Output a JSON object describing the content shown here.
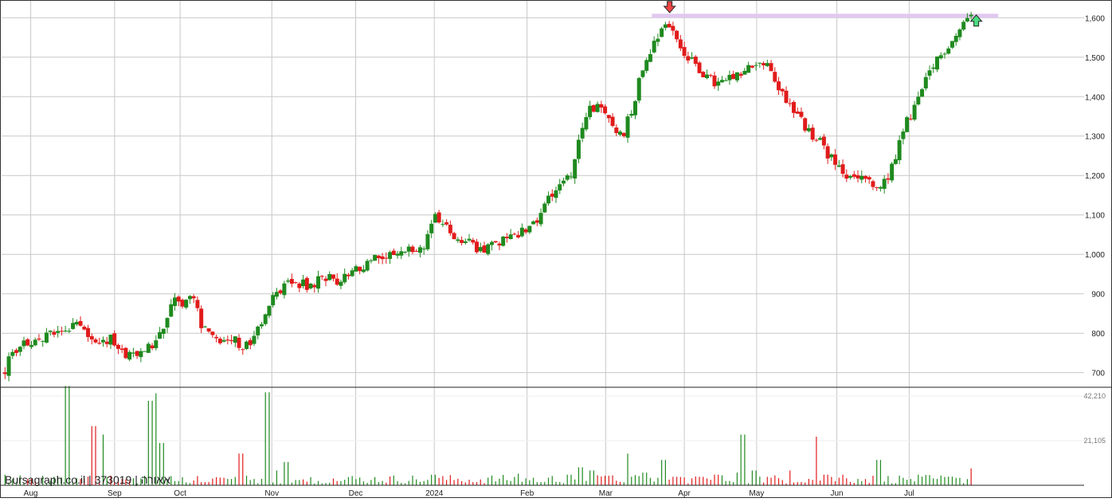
{
  "chart_data": {
    "type": "candlestick",
    "watermark": "Bursagraph.co.il | 373019 | אאורה",
    "grid": true,
    "price_axis": {
      "position": "right",
      "ylim": [
        665,
        1645
      ],
      "ticks": [
        "1,600",
        "1,500",
        "1,400",
        "1,300",
        "1,200",
        "1,100",
        "1,000",
        "900",
        "800",
        "700"
      ],
      "tick_values": [
        1600,
        1500,
        1400,
        1300,
        1200,
        1100,
        1000,
        900,
        800,
        700
      ]
    },
    "volume_axis": {
      "position": "right",
      "ylim": [
        0,
        44500
      ],
      "ticks": [
        "42,210",
        "21,105"
      ],
      "tick_values": [
        42210,
        21105
      ]
    },
    "x_axis": {
      "labels": [
        "Aug",
        "Sep",
        "Oct",
        "Nov",
        "Dec",
        "2024",
        "Feb",
        "Mar",
        "Apr",
        "May",
        "Jun",
        "Jul"
      ],
      "label_positions_week": [
        5.1,
        21.1,
        33.6,
        51.1,
        67.1,
        82.1,
        99.8,
        114.8,
        129.8,
        143.6,
        158.9,
        172.7
      ]
    },
    "resistance_level": {
      "value": 1605,
      "from_week": 123.6,
      "to_week": 189.7,
      "color": "#e2c8f0"
    },
    "markers": [
      {
        "type": "sell-arrow",
        "week": 127,
        "value": 1625,
        "color": "#ef4444"
      },
      {
        "type": "buy-arrow",
        "week": 185.5,
        "value": 1595,
        "color": "#4ade80"
      }
    ],
    "colors": {
      "up": "#1f8a1f",
      "down": "#e11b1b"
    },
    "series_close": [
      [
        0,
        700
      ],
      [
        2,
        760
      ],
      [
        4,
        780
      ],
      [
        6,
        770
      ],
      [
        8,
        800
      ],
      [
        10,
        805
      ],
      [
        12,
        815
      ],
      [
        14,
        820
      ],
      [
        16,
        785
      ],
      [
        18,
        770
      ],
      [
        20,
        790
      ],
      [
        22,
        760
      ],
      [
        24,
        745
      ],
      [
        26,
        750
      ],
      [
        28,
        770
      ],
      [
        30,
        800
      ],
      [
        32,
        880
      ],
      [
        34,
        880
      ],
      [
        36,
        900
      ],
      [
        38,
        810
      ],
      [
        40,
        800
      ],
      [
        42,
        770
      ],
      [
        44,
        780
      ],
      [
        46,
        760
      ],
      [
        48,
        800
      ],
      [
        50,
        850
      ],
      [
        52,
        900
      ],
      [
        54,
        920
      ],
      [
        56,
        930
      ],
      [
        58,
        920
      ],
      [
        60,
        935
      ],
      [
        62,
        940
      ],
      [
        64,
        930
      ],
      [
        66,
        950
      ],
      [
        68,
        960
      ],
      [
        70,
        990
      ],
      [
        72,
        1000
      ],
      [
        74,
        990
      ],
      [
        76,
        1010
      ],
      [
        78,
        1020
      ],
      [
        80,
        1020
      ],
      [
        82,
        1100
      ],
      [
        84,
        1080
      ],
      [
        86,
        1040
      ],
      [
        88,
        1030
      ],
      [
        90,
        1020
      ],
      [
        92,
        1010
      ],
      [
        94,
        1030
      ],
      [
        96,
        1040
      ],
      [
        98,
        1050
      ],
      [
        100,
        1070
      ],
      [
        102,
        1090
      ],
      [
        104,
        1150
      ],
      [
        106,
        1180
      ],
      [
        108,
        1200
      ],
      [
        110,
        1300
      ],
      [
        112,
        1380
      ],
      [
        114,
        1360
      ],
      [
        116,
        1330
      ],
      [
        118,
        1300
      ],
      [
        120,
        1380
      ],
      [
        122,
        1480
      ],
      [
        124,
        1540
      ],
      [
        126,
        1590
      ],
      [
        128,
        1560
      ],
      [
        130,
        1500
      ],
      [
        132,
        1480
      ],
      [
        134,
        1450
      ],
      [
        136,
        1430
      ],
      [
        138,
        1440
      ],
      [
        140,
        1450
      ],
      [
        142,
        1470
      ],
      [
        144,
        1490
      ],
      [
        146,
        1470
      ],
      [
        148,
        1420
      ],
      [
        150,
        1380
      ],
      [
        152,
        1340
      ],
      [
        154,
        1300
      ],
      [
        156,
        1280
      ],
      [
        158,
        1240
      ],
      [
        160,
        1200
      ],
      [
        162,
        1190
      ],
      [
        164,
        1200
      ],
      [
        166,
        1160
      ],
      [
        168,
        1180
      ],
      [
        170,
        1240
      ],
      [
        172,
        1330
      ],
      [
        174,
        1380
      ],
      [
        176,
        1440
      ],
      [
        178,
        1490
      ],
      [
        180,
        1530
      ],
      [
        182,
        1560
      ],
      [
        184,
        1610
      ],
      [
        185,
        1600
      ]
    ],
    "volume_samples": [
      [
        0,
        5000
      ],
      [
        5,
        3000
      ],
      [
        10,
        4000
      ],
      [
        12,
        47000
      ],
      [
        15,
        3000
      ],
      [
        17,
        28000
      ],
      [
        19,
        24000
      ],
      [
        22,
        3000
      ],
      [
        24,
        2000
      ],
      [
        27,
        4500
      ],
      [
        28,
        40000
      ],
      [
        29,
        43500
      ],
      [
        30,
        20000
      ],
      [
        33,
        2000
      ],
      [
        38,
        1500
      ],
      [
        43,
        3000
      ],
      [
        45,
        15000
      ],
      [
        47,
        2500
      ],
      [
        50,
        44000
      ],
      [
        52,
        7000
      ],
      [
        54,
        11000
      ],
      [
        56,
        2500
      ],
      [
        60,
        2000
      ],
      [
        64,
        2000
      ],
      [
        70,
        2500
      ],
      [
        80,
        2000
      ],
      [
        82,
        5000
      ],
      [
        90,
        1500
      ],
      [
        98,
        5500
      ],
      [
        102,
        1500
      ],
      [
        108,
        5000
      ],
      [
        110,
        8500
      ],
      [
        112,
        7000
      ],
      [
        115,
        4500
      ],
      [
        119,
        15000
      ],
      [
        122,
        6000
      ],
      [
        126,
        12000
      ],
      [
        128,
        4000
      ],
      [
        133,
        4000
      ],
      [
        136,
        5000
      ],
      [
        140,
        6000
      ],
      [
        141,
        24000
      ],
      [
        143,
        7000
      ],
      [
        150,
        7000
      ],
      [
        155,
        23000
      ],
      [
        157,
        5000
      ],
      [
        160,
        5000
      ],
      [
        163,
        3000
      ],
      [
        167,
        12000
      ],
      [
        173,
        3000
      ],
      [
        178,
        3000
      ],
      [
        182,
        3500
      ],
      [
        185,
        8000
      ]
    ]
  }
}
